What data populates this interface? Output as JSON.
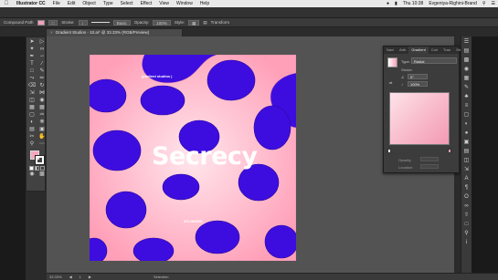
{
  "menubar": {
    "app": "Illustrator CC",
    "items": [
      "File",
      "Edit",
      "Object",
      "Type",
      "Select",
      "Effect",
      "View",
      "Window",
      "Help"
    ],
    "clock": "Thu 10:38",
    "user": "Evgeniya-Righini-Brand"
  },
  "controlbar": {
    "selection": "Compound Path",
    "stroke_label": "Stroke:",
    "brush": "Basic",
    "opacity_label": "Opacity:",
    "opacity": "100%",
    "style_label": "Style:",
    "transform": "Transform",
    "accent_fill": "#f5a6bd"
  },
  "document": {
    "tab_title": "Gradient Studios - 10.ai* @ 33.33% (RGB/Preview)",
    "close": "×"
  },
  "artwork": {
    "label_top": "gradient studios |",
    "title": "Secrecy",
    "label_bottom": "ATLIMOBS",
    "colors": {
      "purple": "#3d0de0",
      "pink": "#ffb8c8",
      "light": "#ffe2ea"
    }
  },
  "gradient_panel": {
    "tabs": [
      "Navi",
      "Artb",
      "Gradient",
      "Colr",
      "Tran",
      "Str"
    ],
    "type_label": "Type:",
    "type_value": "Radial",
    "stroke_label": "Stroke:",
    "angle": "0°",
    "aspect": "100%",
    "opacity_label": "Opacity:",
    "location_label": "Location:",
    "ramp_start": "#ffffff",
    "ramp_end": "#f39ab4"
  },
  "statusbar": {
    "zoom": "33.33%",
    "page": "1",
    "tool": "Selection"
  }
}
